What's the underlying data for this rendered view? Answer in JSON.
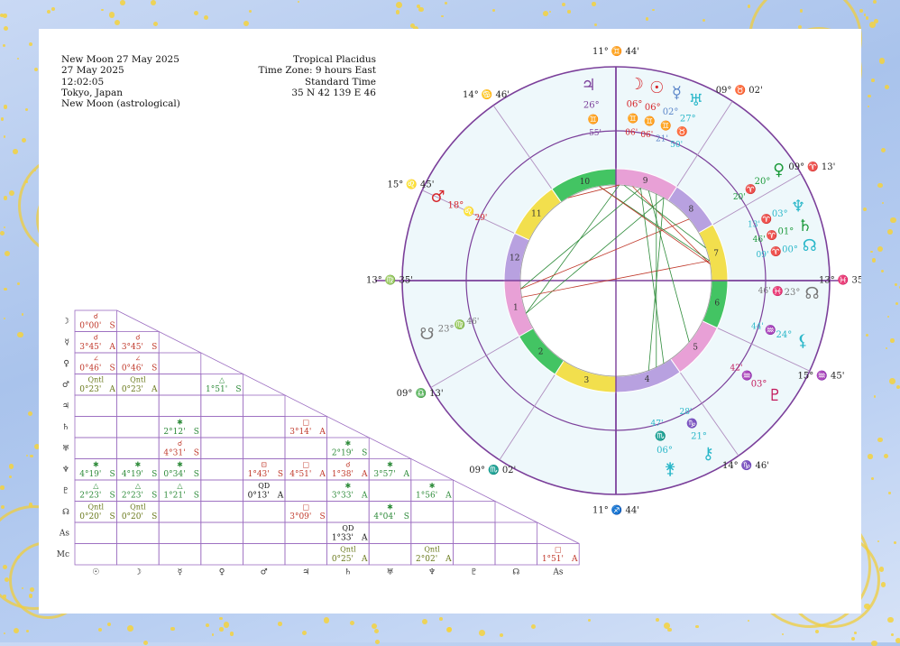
{
  "header_left": [
    "New Moon 27 May 2025",
    "27 May 2025",
    "12:02:05",
    "Tokyo, Japan",
    "New Moon (astrological)"
  ],
  "header_right": [
    "Tropical Placidus",
    "Time Zone: 9 hours East",
    "Standard Time",
    "35 N 42    139 E 46"
  ],
  "colors": {
    "accent": "#7b3f9a",
    "fire": "#d6262b",
    "earth": "#1c9a3b",
    "air": "#c8a700",
    "water": "#2ab7c9",
    "aspect_green": "#2e8b3a",
    "aspect_red": "#c0392b"
  },
  "wheel": {
    "cusps": [
      {
        "deg": "13°",
        "sign": "♍",
        "min": "35'"
      },
      {
        "deg": "09°",
        "sign": "♎",
        "min": "13'"
      },
      {
        "deg": "09°",
        "sign": "♏",
        "min": "02'"
      },
      {
        "deg": "11°",
        "sign": "♐",
        "min": "44'"
      },
      {
        "deg": "14°",
        "sign": "♑",
        "min": "46'"
      },
      {
        "deg": "15°",
        "sign": "♒",
        "min": "45'"
      },
      {
        "deg": "13°",
        "sign": "♓",
        "min": "35'"
      },
      {
        "deg": "09°",
        "sign": "♈",
        "min": "13'"
      },
      {
        "deg": "09°",
        "sign": "♉",
        "min": "02'"
      },
      {
        "deg": "11°",
        "sign": "♊",
        "min": "44'"
      },
      {
        "deg": "14°",
        "sign": "♋",
        "min": "46'"
      },
      {
        "deg": "15°",
        "sign": "♌",
        "min": "45'"
      }
    ],
    "houses": [
      "1",
      "2",
      "3",
      "4",
      "5",
      "6",
      "7",
      "8",
      "9",
      "10",
      "11",
      "12"
    ],
    "planets": [
      {
        "glyph": "☽",
        "deg": "06°",
        "sign": "♊",
        "min": "06'",
        "color": "#d6262b"
      },
      {
        "glyph": "☉",
        "deg": "06°",
        "sign": "♊",
        "min": "06'",
        "color": "#d6262b"
      },
      {
        "glyph": "☿",
        "deg": "02°",
        "sign": "♊",
        "min": "21'",
        "color": "#5b86c9"
      },
      {
        "glyph": "♅",
        "deg": "27°",
        "sign": "♉",
        "min": "50'",
        "color": "#2ab7c9"
      },
      {
        "glyph": "♃",
        "deg": "26°",
        "sign": "♊",
        "min": "55'",
        "color": "#7b3f9a"
      },
      {
        "glyph": "♀",
        "deg": "20°",
        "sign": "♈",
        "min": "20'",
        "color": "#1c9a3b"
      },
      {
        "glyph": "♆",
        "deg": "03°",
        "sign": "♈",
        "min": "13'",
        "color": "#2ab7c9"
      },
      {
        "glyph": "♄",
        "deg": "01°",
        "sign": "♈",
        "min": "46'",
        "color": "#1c9a3b"
      },
      {
        "glyph": "☊",
        "deg": "00°",
        "sign": "♈",
        "min": "09'",
        "color": "#2ab7c9"
      },
      {
        "glyph": "☊",
        "deg": "23°",
        "sign": "♓",
        "min": "46'",
        "color": "#777777"
      },
      {
        "glyph": "⚸",
        "deg": "24°",
        "sign": "♒",
        "min": "44'",
        "color": "#2ab7c9"
      },
      {
        "glyph": "♇",
        "deg": "03°",
        "sign": "♒",
        "min": "42'",
        "color": "#c2185b"
      },
      {
        "glyph": "⚷",
        "deg": "21°",
        "sign": "♑",
        "min": "28'",
        "color": "#2ab7c9"
      },
      {
        "glyph": "⚵",
        "deg": "06°",
        "sign": "♏",
        "min": "47'",
        "color": "#2ab7c9"
      },
      {
        "glyph": "♂",
        "deg": "18°",
        "sign": "♌",
        "min": "29'",
        "color": "#d6262b"
      },
      {
        "glyph": "☋",
        "deg": "23°",
        "sign": "♍",
        "min": "46'",
        "color": "#777777"
      }
    ]
  },
  "aspect_grid": {
    "row_glyphs": [
      "☽",
      "☿",
      "♀",
      "♂",
      "♃",
      "♄",
      "♅",
      "♆",
      "♇",
      "☊",
      "As",
      "Mc"
    ],
    "col_glyphs": [
      "☉",
      "☽",
      "☿",
      "♀",
      "♂",
      "♃",
      "♄",
      "♅",
      "♆",
      "♇",
      "☊",
      "As"
    ],
    "cells": [
      {
        "r": 0,
        "c": 0,
        "name": "☌",
        "orb": "0°00'",
        "type": "S",
        "color": "#c0392b"
      },
      {
        "r": 1,
        "c": 0,
        "name": "☌",
        "orb": "3°45'",
        "type": "A",
        "color": "#c0392b"
      },
      {
        "r": 1,
        "c": 1,
        "name": "☌",
        "orb": "3°45'",
        "type": "S",
        "color": "#c0392b"
      },
      {
        "r": 2,
        "c": 0,
        "name": "∠",
        "orb": "0°46'",
        "type": "S",
        "color": "#c0392b"
      },
      {
        "r": 2,
        "c": 1,
        "name": "∠",
        "orb": "0°46'",
        "type": "S",
        "color": "#c0392b"
      },
      {
        "r": 3,
        "c": 0,
        "name": "Qntl",
        "orb": "0°23'",
        "type": "A",
        "color": "#6b7a1e"
      },
      {
        "r": 3,
        "c": 1,
        "name": "Qntl",
        "orb": "0°23'",
        "type": "A",
        "color": "#6b7a1e"
      },
      {
        "r": 3,
        "c": 3,
        "name": "△",
        "orb": "1°51'",
        "type": "S",
        "color": "#2e8b3a"
      },
      {
        "r": 5,
        "c": 2,
        "name": "✱",
        "orb": "2°12'",
        "type": "S",
        "color": "#2e8b3a"
      },
      {
        "r": 5,
        "c": 5,
        "name": "□",
        "orb": "3°14'",
        "type": "A",
        "color": "#c0392b"
      },
      {
        "r": 6,
        "c": 2,
        "name": "☌",
        "orb": "4°31'",
        "type": "S",
        "color": "#c0392b"
      },
      {
        "r": 6,
        "c": 6,
        "name": "✱",
        "orb": "2°19'",
        "type": "S",
        "color": "#2e8b3a"
      },
      {
        "r": 7,
        "c": 0,
        "name": "✱",
        "orb": "4°19'",
        "type": "S",
        "color": "#2e8b3a"
      },
      {
        "r": 7,
        "c": 1,
        "name": "✱",
        "orb": "4°19'",
        "type": "S",
        "color": "#2e8b3a"
      },
      {
        "r": 7,
        "c": 2,
        "name": "✱",
        "orb": "0°34'",
        "type": "S",
        "color": "#2e8b3a"
      },
      {
        "r": 7,
        "c": 4,
        "name": "⊡",
        "orb": "1°43'",
        "type": "S",
        "color": "#c0392b"
      },
      {
        "r": 7,
        "c": 5,
        "name": "□",
        "orb": "4°51'",
        "type": "A",
        "color": "#c0392b"
      },
      {
        "r": 7,
        "c": 6,
        "name": "☌",
        "orb": "1°38'",
        "type": "A",
        "color": "#c0392b"
      },
      {
        "r": 7,
        "c": 7,
        "name": "✱",
        "orb": "3°57'",
        "type": "A",
        "color": "#2e8b3a"
      },
      {
        "r": 8,
        "c": 0,
        "name": "△",
        "orb": "2°23'",
        "type": "S",
        "color": "#2e8b3a"
      },
      {
        "r": 8,
        "c": 1,
        "name": "△",
        "orb": "2°23'",
        "type": "S",
        "color": "#2e8b3a"
      },
      {
        "r": 8,
        "c": 2,
        "name": "△",
        "orb": "1°21'",
        "type": "S",
        "color": "#2e8b3a"
      },
      {
        "r": 8,
        "c": 4,
        "name": "QD",
        "orb": "0°13'",
        "type": "A",
        "color": "#111111"
      },
      {
        "r": 8,
        "c": 6,
        "name": "✱",
        "orb": "3°33'",
        "type": "A",
        "color": "#2e8b3a"
      },
      {
        "r": 8,
        "c": 8,
        "name": "✱",
        "orb": "1°56'",
        "type": "A",
        "color": "#2e8b3a"
      },
      {
        "r": 9,
        "c": 0,
        "name": "Qntl",
        "orb": "0°20'",
        "type": "S",
        "color": "#6b7a1e"
      },
      {
        "r": 9,
        "c": 1,
        "name": "Qntl",
        "orb": "0°20'",
        "type": "S",
        "color": "#6b7a1e"
      },
      {
        "r": 9,
        "c": 5,
        "name": "□",
        "orb": "3°09'",
        "type": "S",
        "color": "#c0392b"
      },
      {
        "r": 9,
        "c": 7,
        "name": "✱",
        "orb": "4°04'",
        "type": "S",
        "color": "#2e8b3a"
      },
      {
        "r": 10,
        "c": 6,
        "name": "QD",
        "orb": "1°33'",
        "type": "A",
        "color": "#111111"
      },
      {
        "r": 11,
        "c": 6,
        "name": "Qntl",
        "orb": "0°25'",
        "type": "A",
        "color": "#6b7a1e"
      },
      {
        "r": 11,
        "c": 8,
        "name": "Qntl",
        "orb": "2°02'",
        "type": "A",
        "color": "#6b7a1e"
      },
      {
        "r": 11,
        "c": 11,
        "name": "□",
        "orb": "1°51'",
        "type": "A",
        "color": "#c0392b"
      }
    ]
  }
}
